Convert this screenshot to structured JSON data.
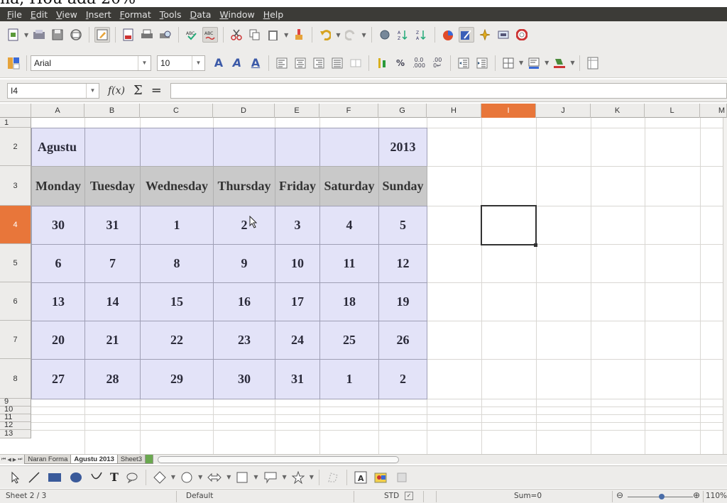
{
  "top_crop_text": "na, Hou ada 20%",
  "menu": [
    "File",
    "Edit",
    "View",
    "Insert",
    "Format",
    "Tools",
    "Data",
    "Window",
    "Help"
  ],
  "toolbar2": {
    "font_name": "Arial",
    "font_size": "10"
  },
  "formula_bar": {
    "name_box": "I4",
    "formula": ""
  },
  "columns": [
    "A",
    "B",
    "C",
    "D",
    "E",
    "F",
    "G",
    "H",
    "I",
    "J",
    "K",
    "L",
    "M"
  ],
  "rows": [
    "1",
    "2",
    "3",
    "4",
    "5",
    "6",
    "7",
    "8",
    "9",
    "10",
    "11",
    "12",
    "13"
  ],
  "selected": {
    "column": "I",
    "row": "4"
  },
  "calendar": {
    "month": "Agustu",
    "year": "2013",
    "weekdays": [
      "Monday",
      "Tuesday",
      "Wednesday",
      "Thursday",
      "Friday",
      "Saturday",
      "Sunday"
    ],
    "weeks": [
      [
        "30",
        "31",
        "1",
        "2",
        "3",
        "4",
        "5"
      ],
      [
        "6",
        "7",
        "8",
        "9",
        "10",
        "11",
        "12"
      ],
      [
        "13",
        "14",
        "15",
        "16",
        "17",
        "18",
        "19"
      ],
      [
        "20",
        "21",
        "22",
        "23",
        "24",
        "25",
        "26"
      ],
      [
        "27",
        "28",
        "29",
        "30",
        "31",
        "1",
        "2"
      ]
    ]
  },
  "sheet_tabs": [
    "Naran Forma",
    "Agustu 2013",
    "Sheet3"
  ],
  "active_sheet": "Agustu 2013",
  "status": {
    "sheet": "Sheet 2 / 3",
    "page_style": "Default",
    "mode": "STD",
    "sum": "Sum=0",
    "zoom": "110%"
  },
  "colors": {
    "menubar": "#3c3b37",
    "selection_header": "#e8763a",
    "calendar_fill": "#e3e3f8",
    "weekday_fill": "#c9c9c9"
  }
}
